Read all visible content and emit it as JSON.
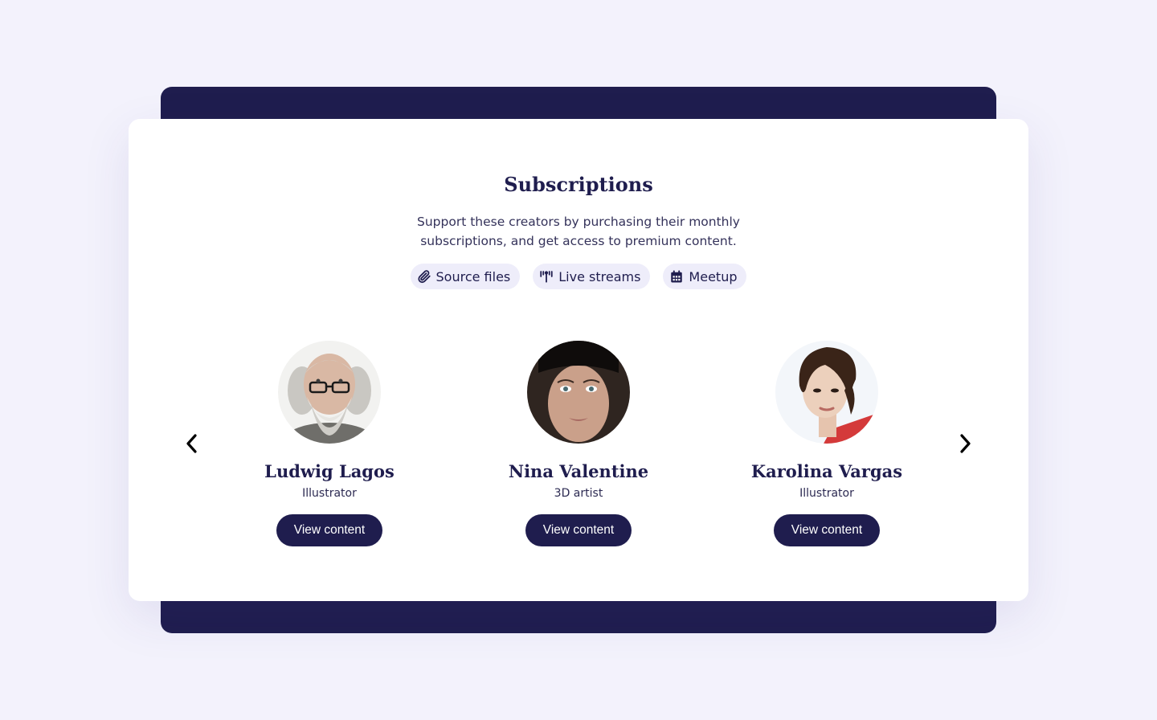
{
  "header": {
    "title": "Subscriptions",
    "description": "Support these creators by purchasing their monthly subscriptions, and get access to premium content."
  },
  "tags": [
    {
      "label": "Source files",
      "icon": "paperclip-icon"
    },
    {
      "label": "Live streams",
      "icon": "broadcast-icon"
    },
    {
      "label": "Meetup",
      "icon": "calendar-icon"
    }
  ],
  "carousel": {
    "prev_icon": "chevron-left-icon",
    "next_icon": "chevron-right-icon"
  },
  "creators": [
    {
      "name": "Ludwig Lagos",
      "role": "Illustrator",
      "button": "View content"
    },
    {
      "name": "Nina Valentine",
      "role": "3D artist",
      "button": "View content"
    },
    {
      "name": "Karolina Vargas",
      "role": "Illustrator",
      "button": "View content"
    }
  ],
  "colors": {
    "page_background": "#f3f2fc",
    "primary_dark": "#1f1d4e",
    "tag_background": "#eeedfa",
    "card_background": "#ffffff"
  }
}
